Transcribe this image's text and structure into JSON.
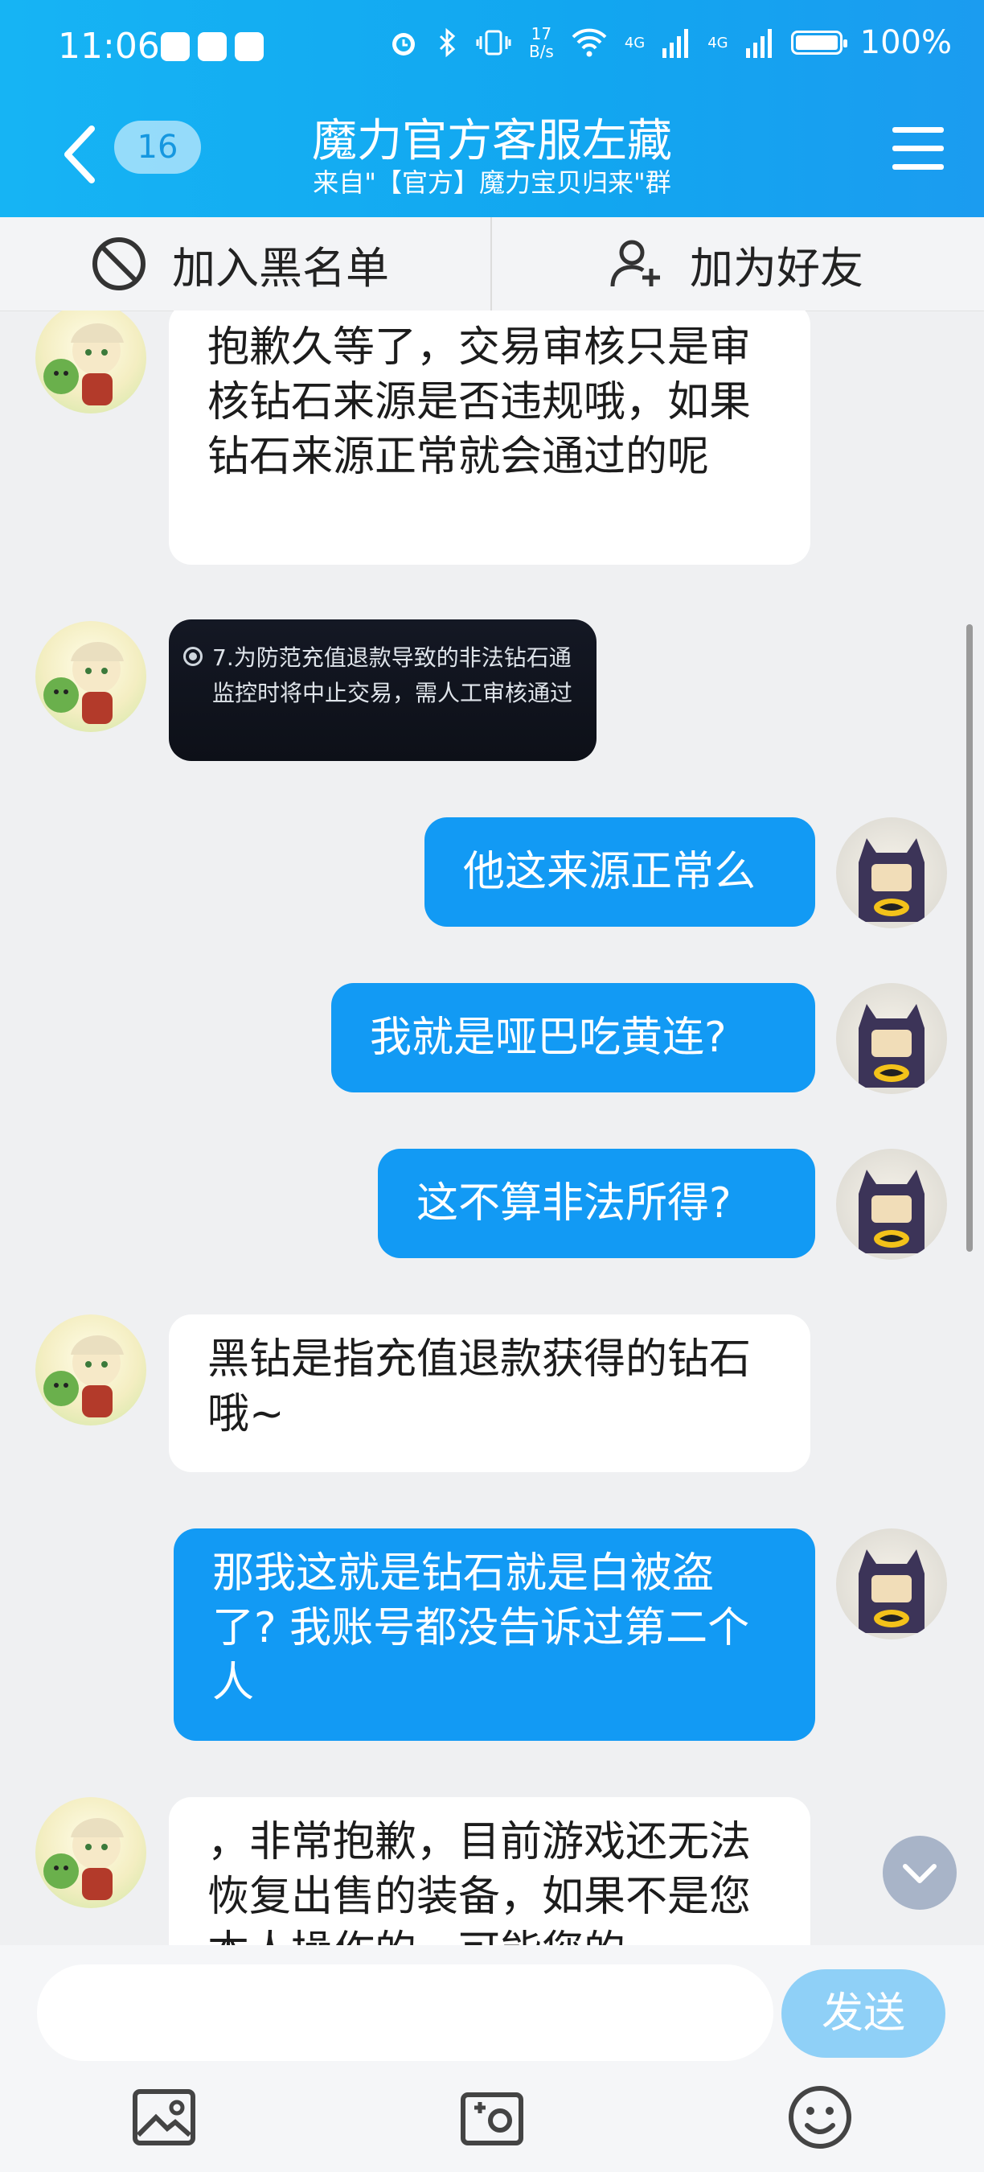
{
  "status_bar": {
    "time": "11:06",
    "net_speed_value": "17",
    "net_speed_unit": "B/s",
    "signal1": "4G",
    "signal2": "4G",
    "battery": "100%"
  },
  "header": {
    "unread_count": "16",
    "title": "魔力官方客服左藏",
    "subtitle": "来自\"【官方】魔力宝贝归来\"群"
  },
  "actions": {
    "block_label": "加入黑名单",
    "add_friend_label": "加为好友"
  },
  "messages": [
    {
      "from": "cs",
      "text": "抱歉久等了，交易审核只是审核钻石来源是否违规哦，如果钻石来源正常就会通过的呢"
    },
    {
      "from": "cs",
      "type": "image",
      "image_text_line1": "7.为防范充值退款导致的非法钻石通",
      "image_text_line2": "监控时将中止交易，需人工审核通过"
    },
    {
      "from": "me",
      "text": "他这来源正常么"
    },
    {
      "from": "me",
      "text": "我就是哑巴吃黄连?"
    },
    {
      "from": "me",
      "text": "这不算非法所得?"
    },
    {
      "from": "cs",
      "text": "黑钻是指充值退款获得的钻石哦~"
    },
    {
      "from": "me",
      "text": "那我这就是钻石就是白被盗了? 我账号都没告诉过第二个人"
    },
    {
      "from": "cs",
      "text": "，非常抱歉，目前游戏还无法恢复出售的装备，如果不是您本人操作的，可能您的"
    }
  ],
  "input": {
    "placeholder": "",
    "send_label": "发送"
  },
  "colors": {
    "header": "#12a6f0",
    "outgoing_bubble": "#129af4",
    "send_button": "#8fd0f7"
  },
  "icons": [
    "back-icon",
    "menu-icon",
    "block-icon",
    "add-friend-icon",
    "scroll-down-icon",
    "image-icon",
    "camera-icon",
    "emoji-icon"
  ]
}
